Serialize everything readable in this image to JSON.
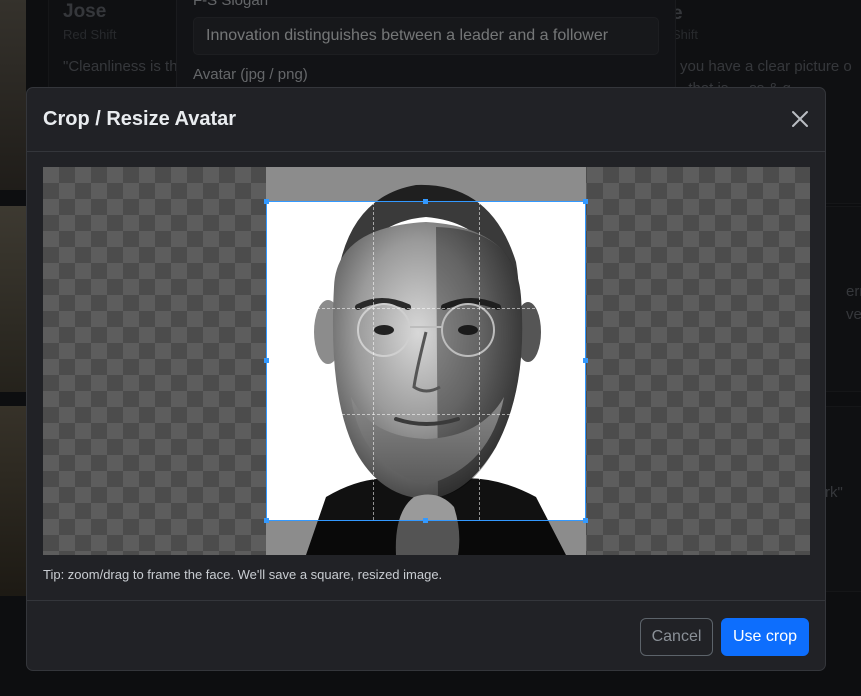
{
  "background": {
    "card1": {
      "name": "Jose",
      "role": "Red Shift",
      "quote": "\"Cleanliness is the",
      "right_name": "e",
      "right_role": "Shift",
      "right_line1": "you have a clear picture o",
      "right_line2": ", that is ... ss & g"
    },
    "card2": {
      "right_line1": "ermi",
      "right_line2": "verar"
    },
    "card3": {
      "right_line1": "rk\""
    },
    "form": {
      "slogan_label": "F-S Slogan",
      "slogan_value": "Innovation distinguishes between a leader and a follower",
      "avatar_label": "Avatar (jpg / png)"
    }
  },
  "modal": {
    "title": "Crop / Resize Avatar",
    "close_icon": "close-icon",
    "tip": "Tip: zoom/drag to frame the face. We'll save a square, resized image.",
    "cancel_label": "Cancel",
    "use_crop_label": "Use crop",
    "colors": {
      "accent": "#0d6efd",
      "crop_border": "#3399ff"
    }
  }
}
